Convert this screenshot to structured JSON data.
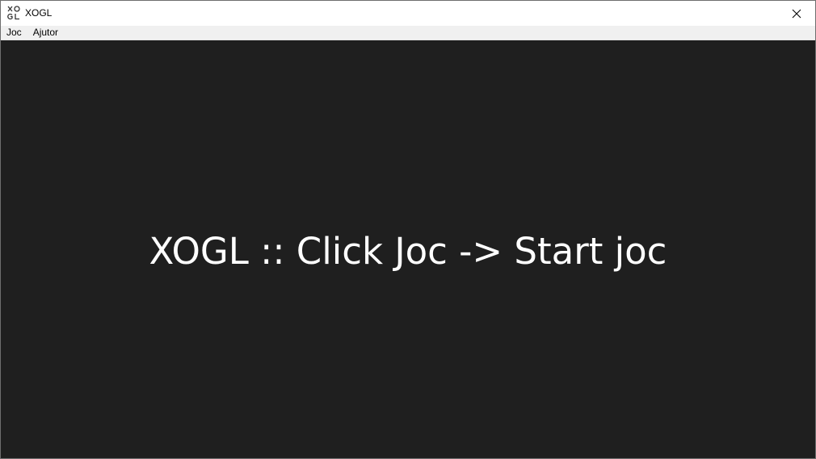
{
  "window": {
    "title": "XOGL",
    "icon": "xogl-app-icon",
    "close_icon": "close-icon"
  },
  "menu": {
    "items": [
      {
        "label": "Joc"
      },
      {
        "label": "Ajutor"
      }
    ]
  },
  "main": {
    "message": "XOGL :: Click Joc -> Start joc"
  },
  "colors": {
    "background": "#1f1f1f",
    "text": "#ffffff",
    "titlebar": "#ffffff",
    "menubar": "#f0f0f0"
  }
}
